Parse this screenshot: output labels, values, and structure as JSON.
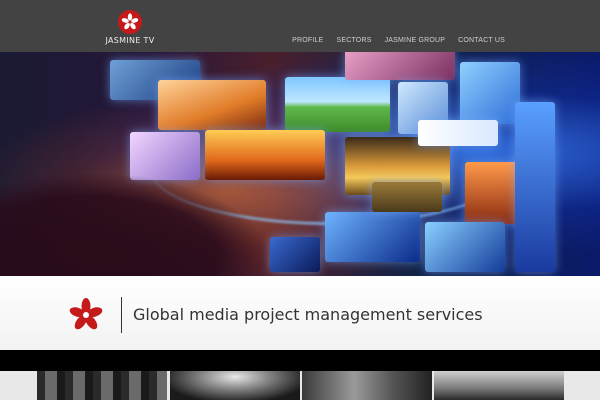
{
  "brand": {
    "name": "JASMINE TV",
    "logo_icon": "jasmine-flower-icon",
    "accent_color": "#c41a1a"
  },
  "nav": {
    "items": [
      "PROFILE",
      "SECTORS",
      "JASMINE GROUP",
      "CONTACT US"
    ]
  },
  "hero": {
    "image": "media-screens-banner"
  },
  "tagline": {
    "text": "Global media project management services",
    "icon": "jasmine-flower-icon"
  },
  "thumbnails": [
    {
      "image": "editing-suite-thumbnail"
    },
    {
      "image": "concert-stage-thumbnail"
    },
    {
      "image": "film-crew-thumbnail"
    },
    {
      "image": "channel-branding-thumbnail"
    }
  ],
  "colors": {
    "topbar": "#434343",
    "tagline_text": "#333333",
    "nav_text": "#cfcfcf"
  }
}
